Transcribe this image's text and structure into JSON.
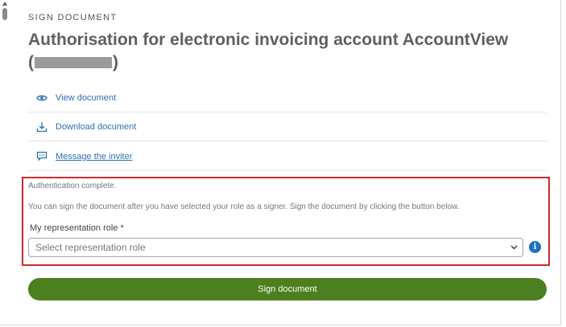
{
  "header": {
    "eyebrow": "SIGN DOCUMENT",
    "title_main": "Authorisation for electronic invoicing account AccountView",
    "title_open_paren": "(",
    "title_close_paren": ")"
  },
  "actions": [
    {
      "label": "View document",
      "icon": "eye-icon"
    },
    {
      "label": "Download document",
      "icon": "download-icon"
    },
    {
      "label": "Message the inviter",
      "icon": "message-icon"
    }
  ],
  "signing": {
    "status": "Authentication complete.",
    "instructions": "You can sign the document after you have selected your role as a signer. Sign the document by clicking the button below.",
    "role_label": "My representation role",
    "required_marker": "*",
    "role_placeholder": "Select representation role",
    "info_symbol": "i",
    "sign_button": "Sign document"
  },
  "colors": {
    "link": "#2c6fb7",
    "sign_button": "#4c7f1f",
    "highlight_border": "#cc2a2a",
    "info": "#1a6fc8"
  }
}
